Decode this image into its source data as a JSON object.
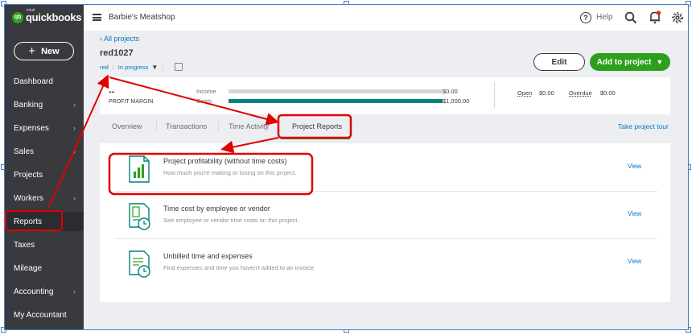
{
  "brand": {
    "logo_mark": "qb",
    "intuit": "intuit",
    "name": "quickbooks"
  },
  "sidebar": {
    "new_label": "New",
    "items": [
      {
        "label": "Dashboard",
        "chevron": false
      },
      {
        "label": "Banking",
        "chevron": true
      },
      {
        "label": "Expenses",
        "chevron": true
      },
      {
        "label": "Sales",
        "chevron": true
      },
      {
        "label": "Projects",
        "chevron": false
      },
      {
        "label": "Workers",
        "chevron": true
      },
      {
        "label": "Reports",
        "chevron": false,
        "active": true
      },
      {
        "label": "Taxes",
        "chevron": false
      },
      {
        "label": "Mileage",
        "chevron": false
      },
      {
        "label": "Accounting",
        "chevron": true
      },
      {
        "label": "My Accountant",
        "chevron": false
      }
    ]
  },
  "header": {
    "company": "Barbie's Meatshop",
    "help_icon": "?",
    "help_label": "Help",
    "icons": [
      "search-icon",
      "bell-icon",
      "gear-icon"
    ]
  },
  "project": {
    "back_link": "All projects",
    "name": "red1027",
    "customer": "red",
    "status": "In progress",
    "edit_label": "Edit",
    "add_label": "Add to project"
  },
  "summary": {
    "profit_margin_value": "--",
    "profit_margin_label": "PROFIT MARGIN",
    "income_label": "Income",
    "income_amount": "$0.00",
    "income_fraction": 0,
    "costs_label": "Costs",
    "costs_amount": "$1,000.00",
    "costs_fraction": 1,
    "open_label": "Open",
    "open_amount": "$0.00",
    "overdue_label": "Overdue",
    "overdue_amount": "$0.00"
  },
  "tabs": {
    "items": [
      "Overview",
      "Transactions",
      "Time Activity",
      "Project Reports"
    ],
    "active_index": 3,
    "tour_link": "Take project tour"
  },
  "reports": [
    {
      "title": "Project profitability (without time costs)",
      "description": "How much you're making or losing on this project.",
      "view": "View"
    },
    {
      "title": "Time cost by employee or vendor",
      "description": "See employee or vendor time costs on this project.",
      "view": "View"
    },
    {
      "title": "Unbilled time and expenses",
      "description": "Find expenses and time you haven't added to an invoice.",
      "view": "View"
    }
  ],
  "colors": {
    "accent_green": "#2ca01c",
    "link_blue": "#0077c5",
    "annotation_red": "#e00000",
    "sidebar_bg": "#393a3d",
    "bar_teal": "#00827d"
  }
}
